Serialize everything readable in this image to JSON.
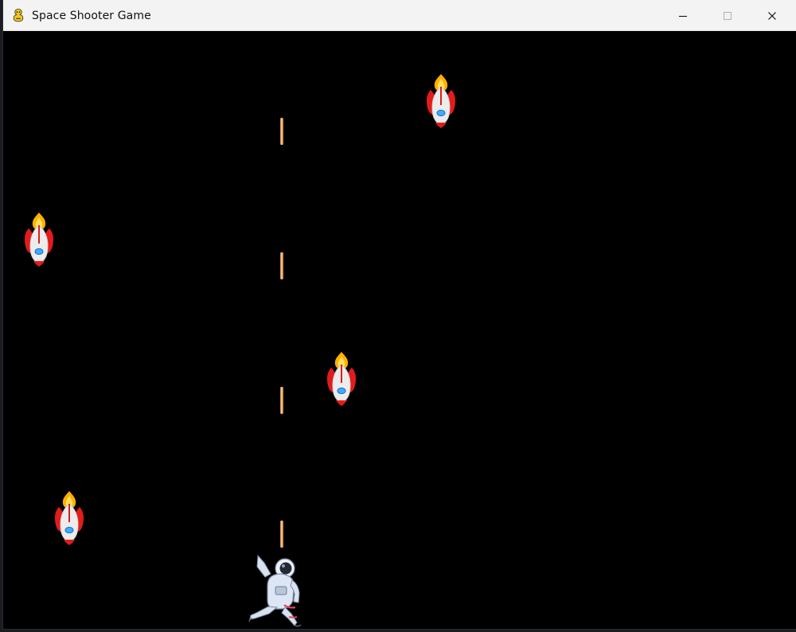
{
  "window": {
    "title": "Space Shooter Game",
    "icons": {
      "app": "pygame-snake-icon",
      "minimize": "minimize-icon",
      "maximize": "maximize-icon",
      "close": "close-icon"
    }
  },
  "game": {
    "background_color": "#000000",
    "enemies_count_visible": 4,
    "bullets_count_visible": 4,
    "player": "astronaut"
  },
  "colors": {
    "titlebar": "#f3f3f3",
    "enemy_body": "#e9e9e9",
    "enemy_fins": "#e21b1b",
    "enemy_flame": "#ffb300",
    "enemy_window": "#43a9ff",
    "bullet": "#c98a45"
  }
}
